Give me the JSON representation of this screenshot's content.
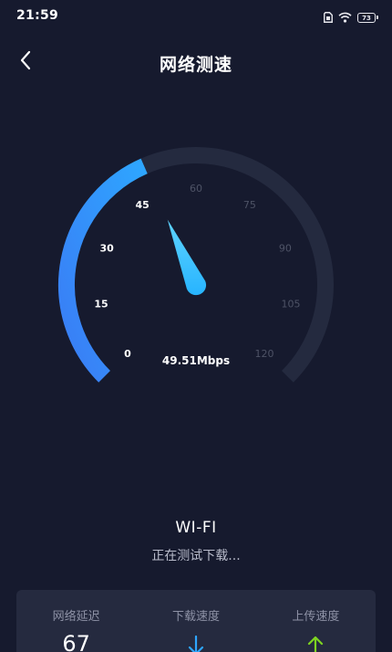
{
  "status_bar": {
    "time": "21:59",
    "battery_level": "73",
    "icons": [
      "sim-card-icon",
      "wifi-icon",
      "battery-icon"
    ]
  },
  "header": {
    "title": "网络测速",
    "back_icon": "chevron-left-icon"
  },
  "gauge": {
    "ticks": [
      "0",
      "15",
      "30",
      "45",
      "60",
      "75",
      "90",
      "105",
      "120"
    ],
    "max": 120,
    "current_value": 49.51,
    "speed_text": "49.51Mbps",
    "colors": {
      "track": "#242a3f",
      "progress_start": "#3a7cf5",
      "progress_end": "#2ea6ff",
      "needle": "#27b4ff",
      "active_label": "#ffffff",
      "inactive_label": "#4e5366"
    }
  },
  "network": {
    "type": "WI-FI",
    "status": "正在测试下载..."
  },
  "stats": [
    {
      "label": "网络延迟",
      "value": "67",
      "icon": ""
    },
    {
      "label": "下载速度",
      "value": "",
      "icon": "arrow-down-icon",
      "icon_color": "#2ea6ff"
    },
    {
      "label": "上传速度",
      "value": "",
      "icon": "arrow-up-icon",
      "icon_color": "#7ed321"
    }
  ]
}
